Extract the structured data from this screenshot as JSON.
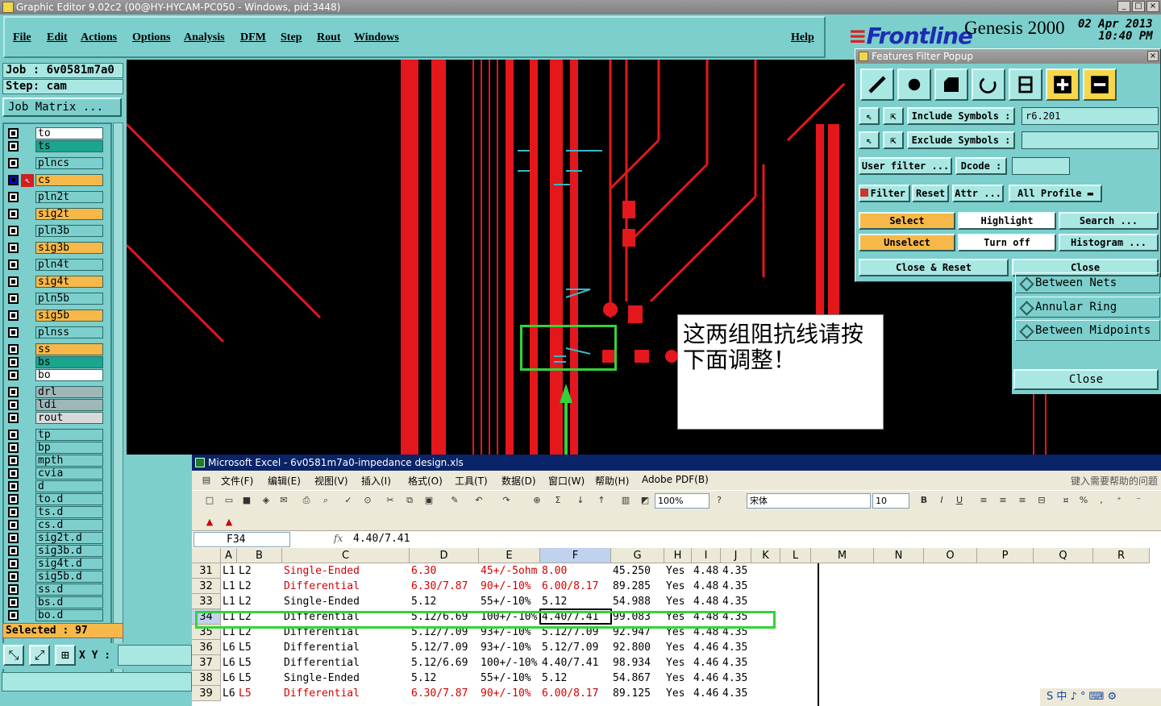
{
  "window": {
    "title": "Graphic Editor 9.02c2 (00@HY-HYCAM-PC050 - Windows, pid:3448)"
  },
  "menu": [
    "File",
    "Edit",
    "Actions",
    "Options",
    "Analysis",
    "DFM",
    "Step",
    "Rout",
    "Windows"
  ],
  "help_label": "Help",
  "brand": {
    "logo": "Frontline",
    "product": "Genesis 2000",
    "date": "02 Apr 2013",
    "time": "10:40 PM"
  },
  "job": {
    "job": "Job : 6v0581m7a0",
    "step": "Step: cam",
    "matrix_label": "Job Matrix ..."
  },
  "layers": [
    {
      "name": "to",
      "color": "#ffffff"
    },
    {
      "name": "ts",
      "color": "#1aa58e"
    },
    {
      "name": "plncs",
      "color": "#7ccfcc"
    },
    {
      "name": "cs",
      "color": "#f7b84a"
    },
    {
      "name": "pln2t",
      "color": "#7ccfcc"
    },
    {
      "name": "sig2t",
      "color": "#f7b84a"
    },
    {
      "name": "pln3b",
      "color": "#7ccfcc"
    },
    {
      "name": "sig3b",
      "color": "#f7b84a"
    },
    {
      "name": "pln4t",
      "color": "#7ccfcc"
    },
    {
      "name": "sig4t",
      "color": "#f7b84a"
    },
    {
      "name": "pln5b",
      "color": "#7ccfcc"
    },
    {
      "name": "sig5b",
      "color": "#f7b84a"
    },
    {
      "name": "plnss",
      "color": "#7ccfcc"
    },
    {
      "name": "ss",
      "color": "#f7b84a"
    },
    {
      "name": "bs",
      "color": "#1aa58e"
    },
    {
      "name": "bo",
      "color": "#ffffff"
    },
    {
      "name": "drl",
      "color": "#9fb7b6"
    },
    {
      "name": "ldi",
      "color": "#9fb7b6"
    },
    {
      "name": "rout",
      "color": "#d9d9d9"
    },
    {
      "name": "tp",
      "color": "#7ccfcc"
    },
    {
      "name": "bp",
      "color": "#7ccfcc"
    },
    {
      "name": "mpth",
      "color": "#7ccfcc"
    },
    {
      "name": "cvia",
      "color": "#7ccfcc"
    },
    {
      "name": "d",
      "color": "#7ccfcc"
    },
    {
      "name": "to.d",
      "color": "#7ccfcc"
    },
    {
      "name": "ts.d",
      "color": "#7ccfcc"
    },
    {
      "name": "cs.d",
      "color": "#7ccfcc"
    },
    {
      "name": "sig2t.d",
      "color": "#7ccfcc"
    },
    {
      "name": "sig3b.d",
      "color": "#7ccfcc"
    },
    {
      "name": "sig4t.d",
      "color": "#7ccfcc"
    },
    {
      "name": "sig5b.d",
      "color": "#7ccfcc"
    },
    {
      "name": "ss.d",
      "color": "#7ccfcc"
    },
    {
      "name": "bs.d",
      "color": "#7ccfcc"
    },
    {
      "name": "bo.d",
      "color": "#7ccfcc"
    }
  ],
  "selected": "Selected : 97",
  "xy_label": "X Y :",
  "note": "这两组阻抗线请按下面调整！",
  "filter_popup": {
    "title": "Features Filter Popup",
    "include_label": "Include Symbols :",
    "include_value": "r6.201",
    "exclude_label": "Exclude Symbols :",
    "exclude_value": "",
    "user_filter": "User filter ...",
    "dcode": "Dcode :",
    "filter": "Filter",
    "reset": "Reset",
    "attr": "Attr ...",
    "profile": "All Profile",
    "select": "Select",
    "highlight": "Highlight",
    "search": "Search ...",
    "unselect": "Unselect",
    "turn_off": "Turn off",
    "histogram": "Histogram ...",
    "close_reset": "Close & Reset",
    "close": "Close"
  },
  "side_panel": {
    "items": [
      "Between Nets",
      "Annular Ring",
      "Between Midpoints"
    ],
    "close": "Close"
  },
  "excel": {
    "title": "Microsoft Excel - 6v0581m7a0-impedance design.xls",
    "menu": [
      "文件(F)",
      "编辑(E)",
      "视图(V)",
      "插入(I)",
      "格式(O)",
      "工具(T)",
      "数据(D)",
      "窗口(W)",
      "帮助(H)",
      "Adobe PDF(B)"
    ],
    "help_prompt": "键入需要帮助的问题",
    "zoom": "100%",
    "font": "宋体",
    "font_size": "10",
    "name_box": "F34",
    "formula": "4.40/7.41",
    "columns": [
      "A",
      "B",
      "C",
      "D",
      "E",
      "F",
      "G",
      "H",
      "I",
      "J",
      "K",
      "L",
      "M",
      "N",
      "O",
      "P",
      "Q",
      "R"
    ],
    "rows": [
      {
        "n": "31",
        "a": "L1",
        "b": "L2",
        "c": "Single-Ended",
        "d": "6.30",
        "e": "45+/-5ohm",
        "f": "8.00",
        "g": "45.250",
        "h": "Yes",
        "i": "4.48",
        "j": "4.35",
        "red": true
      },
      {
        "n": "32",
        "a": "L1",
        "b": "L2",
        "c": "Differential",
        "d": "6.30/7.87",
        "e": "90+/-10%",
        "f": "6.00/8.17",
        "g": "89.285",
        "h": "Yes",
        "i": "4.48",
        "j": "4.35",
        "red": true
      },
      {
        "n": "33",
        "a": "L1",
        "b": "L2",
        "c": "Single-Ended",
        "d": "5.12",
        "e": "55+/-10%",
        "f": "5.12",
        "g": "54.988",
        "h": "Yes",
        "i": "4.48",
        "j": "4.35",
        "red": false
      },
      {
        "n": "34",
        "a": "L1",
        "b": "L2",
        "c": "Differential",
        "d": "5.12/6.69",
        "e": "100+/-10%",
        "f": "4.40/7.41",
        "g": "99.083",
        "h": "Yes",
        "i": "4.48",
        "j": "4.35",
        "red": false
      },
      {
        "n": "35",
        "a": "L1",
        "b": "L2",
        "c": "Differential",
        "d": "5.12/7.09",
        "e": "93+/-10%",
        "f": "5.12/7.09",
        "g": "92.947",
        "h": "Yes",
        "i": "4.48",
        "j": "4.35",
        "red": false
      },
      {
        "n": "36",
        "a": "L6",
        "b": "L5",
        "c": "Differential",
        "d": "5.12/7.09",
        "e": "93+/-10%",
        "f": "5.12/7.09",
        "g": "92.800",
        "h": "Yes",
        "i": "4.46",
        "j": "4.35",
        "red": false
      },
      {
        "n": "37",
        "a": "L6",
        "b": "L5",
        "c": "Differential",
        "d": "5.12/6.69",
        "e": "100+/-10%",
        "f": "4.40/7.41",
        "g": "98.934",
        "h": "Yes",
        "i": "4.46",
        "j": "4.35",
        "red": false
      },
      {
        "n": "38",
        "a": "L6",
        "b": "L5",
        "c": "Single-Ended",
        "d": "5.12",
        "e": "55+/-10%",
        "f": "5.12",
        "g": "54.867",
        "h": "Yes",
        "i": "4.46",
        "j": "4.35",
        "red": false
      },
      {
        "n": "39",
        "a": "L6",
        "b": "L5",
        "c": "Differential",
        "d": "6.30/7.87",
        "e": "90+/-10%",
        "f": "6.00/8.17",
        "g": "89.125",
        "h": "Yes",
        "i": "4.46",
        "j": "4.35",
        "red": true
      }
    ],
    "tray": "S 中 ♪ ° ⌨ ⚙"
  }
}
